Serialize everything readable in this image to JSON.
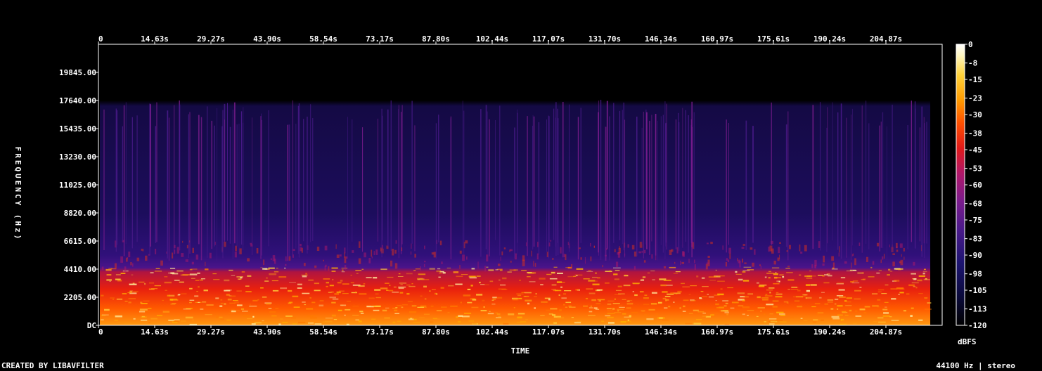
{
  "chart_data": {
    "type": "heatmap",
    "title": "",
    "xlabel": "TIME",
    "ylabel": "FREQUENCY (Hz)",
    "x_ticks": [
      "0",
      "14.63s",
      "29.27s",
      "43.90s",
      "58.54s",
      "73.17s",
      "87.80s",
      "102.44s",
      "117.07s",
      "131.70s",
      "146.34s",
      "160.97s",
      "175.61s",
      "190.24s",
      "204.87s"
    ],
    "y_ticks": [
      "DC",
      "2205.00",
      "4410.00",
      "6615.00",
      "8820.00",
      "11025.00",
      "13230.00",
      "15435.00",
      "17640.00",
      "19845.00"
    ],
    "x_range_s": [
      0,
      219.5
    ],
    "y_range_hz": [
      0,
      22050
    ],
    "colorbar": {
      "label": "dBFS",
      "ticks": [
        "0",
        "-8",
        "-15",
        "-23",
        "-30",
        "-38",
        "-45",
        "-53",
        "-60",
        "-68",
        "-75",
        "-83",
        "-90",
        "-98",
        "-105",
        "-113",
        "-120"
      ],
      "range": [
        -120,
        0
      ],
      "colors": [
        "#000000",
        "#0a0a3a",
        "#1c1470",
        "#4a1a8a",
        "#7a1c8c",
        "#b0186a",
        "#e01a1a",
        "#ff5000",
        "#ff9a00",
        "#ffd23a",
        "#fff6c0",
        "#ffffff"
      ]
    },
    "signal_end_s": 216.4,
    "energy_profile": {
      "strong_band_hz": [
        0,
        4600
      ],
      "moderate_band_hz": [
        4600,
        6700
      ],
      "weak_band_hz": [
        6700,
        17700
      ],
      "cutoff_hz": 17700
    }
  },
  "footer": {
    "credit": "CREATED BY LIBAVFILTER",
    "sample_rate": "44100 Hz | stereo"
  }
}
